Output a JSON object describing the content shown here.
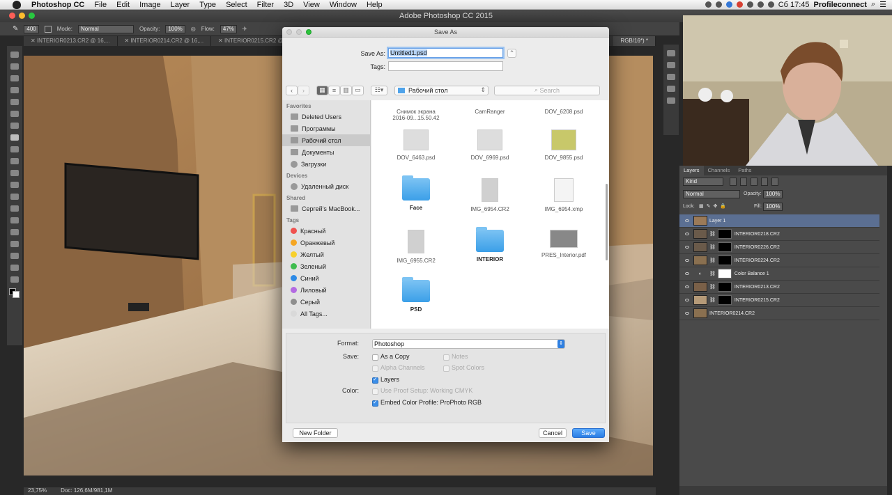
{
  "menubar": {
    "app": "Photoshop CC",
    "items": [
      "File",
      "Edit",
      "Image",
      "Layer",
      "Type",
      "Select",
      "Filter",
      "3D",
      "View",
      "Window",
      "Help"
    ],
    "clock": "Сб 17:45",
    "user": "Profileconnect"
  },
  "window_title": "Adobe Photoshop CC 2015",
  "options_bar": {
    "brush_size": "400",
    "mode_label": "Mode:",
    "mode_value": "Normal",
    "opacity_label": "Opacity:",
    "opacity_value": "100%",
    "flow_label": "Flow:",
    "flow_value": "47%"
  },
  "doc_tabs": [
    "INTERIOR0213.CR2 @ 16,...",
    "INTERIOR0214.CR2 @ 16,...",
    "INTERIOR0215.CR2 @ 16,...",
    "RGB/16*) *"
  ],
  "status": {
    "zoom": "23,75%",
    "doc": "Doc: 126,6M/981,1M"
  },
  "dialog": {
    "title": "Save As",
    "save_as_label": "Save As:",
    "filename": "Untitled1.psd",
    "tags_label": "Tags:",
    "location": "Рабочий стол",
    "search_placeholder": "Search",
    "sidebar": {
      "favorites_header": "Favorites",
      "favorites": [
        "Deleted Users",
        "Программы",
        "Рабочий стол",
        "Документы",
        "Загрузки"
      ],
      "devices_header": "Devices",
      "devices": [
        "Удаленный диск"
      ],
      "shared_header": "Shared",
      "shared": [
        "Сергей's MacBook..."
      ],
      "tags_header": "Tags",
      "tags": [
        {
          "label": "Красный",
          "color": "#f0524f"
        },
        {
          "label": "Оранжевый",
          "color": "#f5a623"
        },
        {
          "label": "Желтый",
          "color": "#f7d02c"
        },
        {
          "label": "Зеленый",
          "color": "#3fbc4f"
        },
        {
          "label": "Синий",
          "color": "#2e8ae6"
        },
        {
          "label": "Лиловый",
          "color": "#b36ae2"
        },
        {
          "label": "Серый",
          "color": "#8e8e8e"
        },
        {
          "label": "All Tags...",
          "color": "#d9d9d9"
        }
      ]
    },
    "files": [
      {
        "name": "Снимок экрана\n2016-09...15.50.42",
        "kind": "img"
      },
      {
        "name": "CamRanger",
        "kind": "img"
      },
      {
        "name": "DOV_6208.psd",
        "kind": "img"
      },
      {
        "name": "DOV_6463.psd",
        "kind": "img"
      },
      {
        "name": "DOV_6969.psd",
        "kind": "img"
      },
      {
        "name": "DOV_9855.psd",
        "kind": "img"
      },
      {
        "name": "Face",
        "kind": "folder"
      },
      {
        "name": "IMG_6954.CR2",
        "kind": "img"
      },
      {
        "name": "IMG_6954.xmp",
        "kind": "doc"
      },
      {
        "name": "IMG_6955.CR2",
        "kind": "img"
      },
      {
        "name": "INTERIOR",
        "kind": "folder"
      },
      {
        "name": "PRES_Interior.pdf",
        "kind": "pdf"
      },
      {
        "name": "PSD",
        "kind": "folder"
      }
    ],
    "format_label": "Format:",
    "format_value": "Photoshop",
    "save_label": "Save:",
    "as_copy": "As a Copy",
    "notes": "Notes",
    "alpha": "Alpha Channels",
    "spot": "Spot Colors",
    "layers": "Layers",
    "color_label": "Color:",
    "proof": "Use Proof Setup:  Working CMYK",
    "embed": "Embed Color Profile:  ProPhoto RGB",
    "new_folder": "New Folder",
    "cancel": "Cancel",
    "save": "Save"
  },
  "layers_panel": {
    "tabs": [
      "Layers",
      "Channels",
      "Paths"
    ],
    "kind": "Kind",
    "blend": "Normal",
    "opacity_label": "Opacity:",
    "opacity": "100%",
    "lock_label": "Lock:",
    "fill_label": "Fill:",
    "fill": "100%",
    "layers": [
      "Layer 1",
      "INTERIOR0218.CR2",
      "INTERIOR0226.CR2",
      "INTERIOR0224.CR2",
      "Color Balance 1",
      "INTERIOR0213.CR2",
      "INTERIOR0215.CR2",
      "INTERIOR0214.CR2"
    ]
  }
}
